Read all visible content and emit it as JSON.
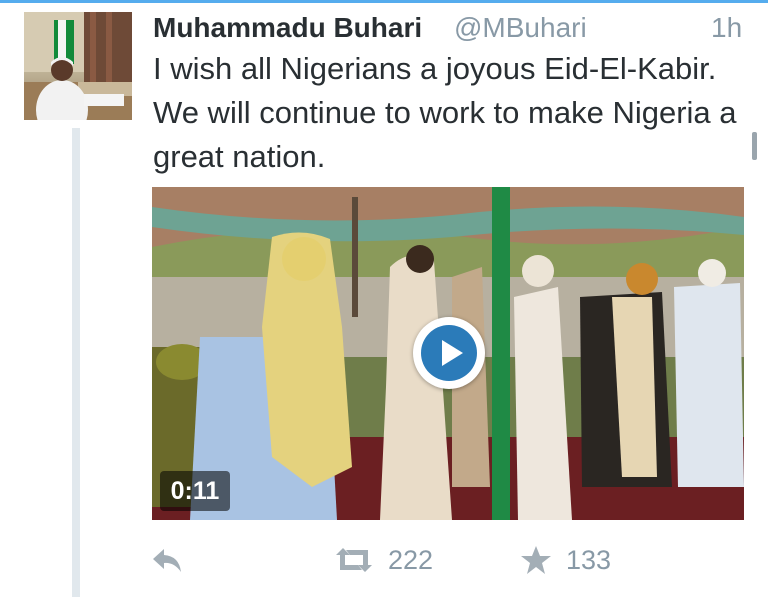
{
  "tweet": {
    "author_name": "Muhammadu Buhari",
    "handle": "@MBuhari",
    "time": "1h",
    "text": "I wish all Nigerians a joyous Eid-El-Kabir. We will continue to work to make Nigeria a great nation."
  },
  "media": {
    "type": "video",
    "duration": "0:11",
    "play_icon": "play-icon"
  },
  "actions": {
    "reply_icon": "reply-icon",
    "retweet_icon": "retweet-icon",
    "retweet_count": "222",
    "favorite_icon": "star-icon",
    "favorite_count": "133"
  },
  "colors": {
    "accent": "#55acee",
    "play_button": "#2b7bb9",
    "text": "#292f33",
    "secondary_text": "#8899a6",
    "icon": "#a3aeb6",
    "thread_line": "#e1e8ed"
  }
}
